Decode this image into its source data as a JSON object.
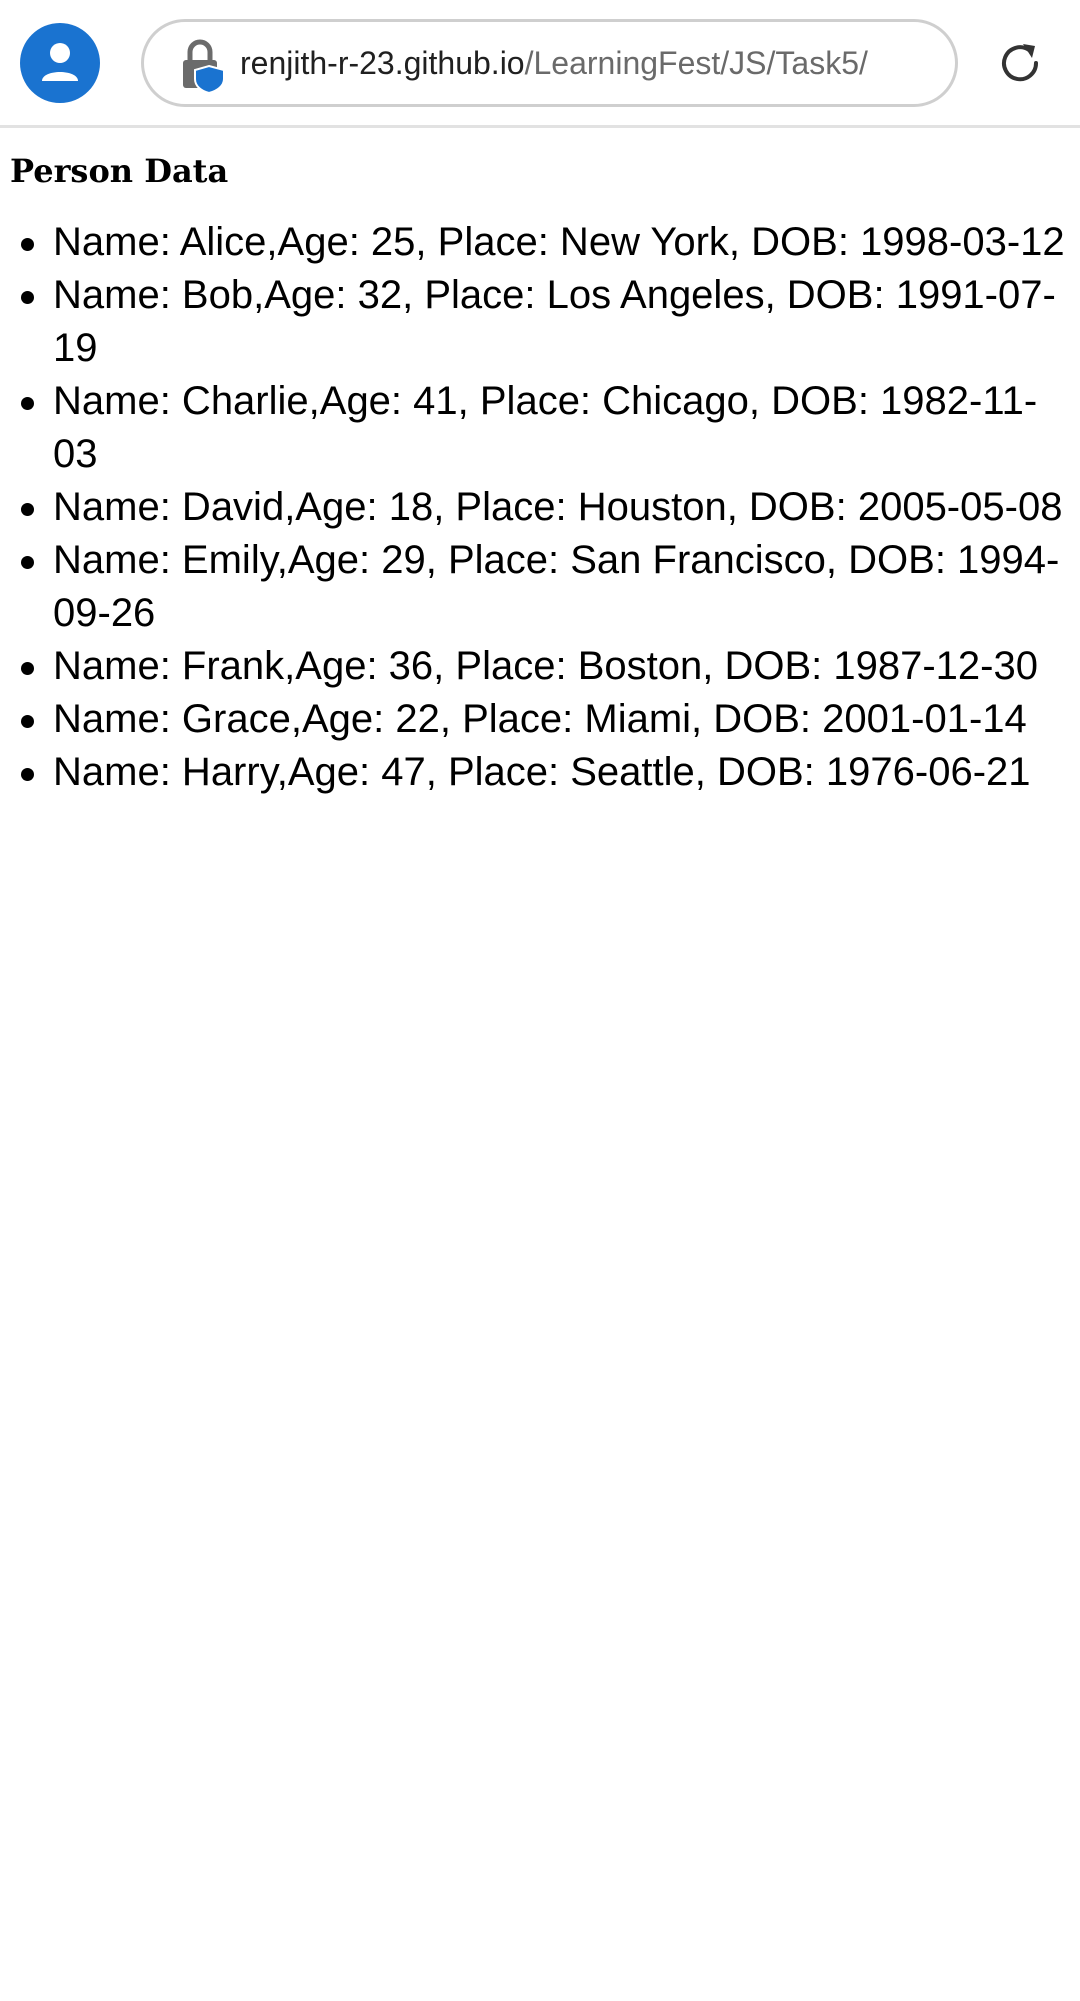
{
  "browser": {
    "url_host": "renjith-r-23.github.io",
    "url_path": "/LearningFest/JS/Task5/",
    "icons": {
      "profile": "account-circle-icon",
      "security": "lock-shield-icon",
      "reload": "reload-icon"
    },
    "accent_color": "#1a73d0"
  },
  "page": {
    "title": "Person Data",
    "people": [
      {
        "text": "Name: Alice,Age: 25, Place: New York, DOB: 1998-03-12"
      },
      {
        "text": "Name: Bob,Age: 32, Place: Los Angeles, DOB: 1991-07-19"
      },
      {
        "text": "Name: Charlie,Age: 41, Place: Chicago, DOB: 1982-11-03"
      },
      {
        "text": "Name: David,Age: 18, Place: Houston, DOB: 2005-05-08"
      },
      {
        "text": "Name: Emily,Age: 29, Place: San Francisco, DOB: 1994-09-26"
      },
      {
        "text": "Name: Frank,Age: 36, Place: Boston, DOB: 1987-12-30"
      },
      {
        "text": "Name: Grace,Age: 22, Place: Miami, DOB: 2001-01-14"
      },
      {
        "text": "Name: Harry,Age: 47, Place: Seattle, DOB: 1976-06-21"
      }
    ]
  }
}
